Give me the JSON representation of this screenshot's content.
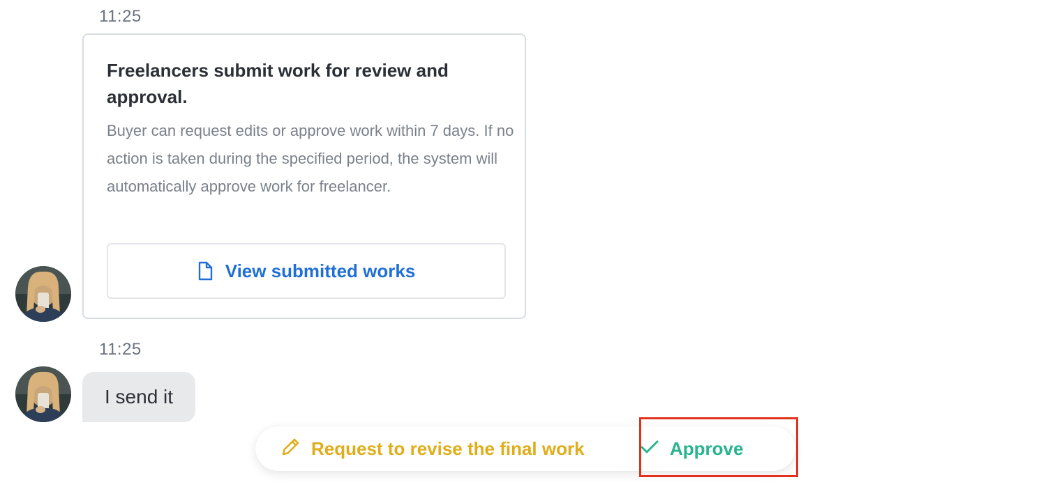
{
  "messages": [
    {
      "timestamp": "11:25",
      "card": {
        "title": "Freelancers submit work for review and approval.",
        "description": "Buyer can request edits or approve work within 7 days. If no action is taken during the specified period, the system will automatically approve work for freelancer.",
        "view_button": {
          "label": "View submitted works",
          "icon": "document-icon"
        }
      },
      "avatar": "avatar"
    },
    {
      "timestamp": "11:25",
      "text": "I send it",
      "avatar": "avatar"
    }
  ],
  "actions": {
    "revise": {
      "label": "Request to revise the final work",
      "icon": "pencil-icon",
      "color": "#e0ad1a"
    },
    "approve": {
      "label": "Approve",
      "icon": "check-icon",
      "color": "#27b48f"
    }
  },
  "colors": {
    "link": "#1f6fd6",
    "highlight": "#e2321d"
  }
}
